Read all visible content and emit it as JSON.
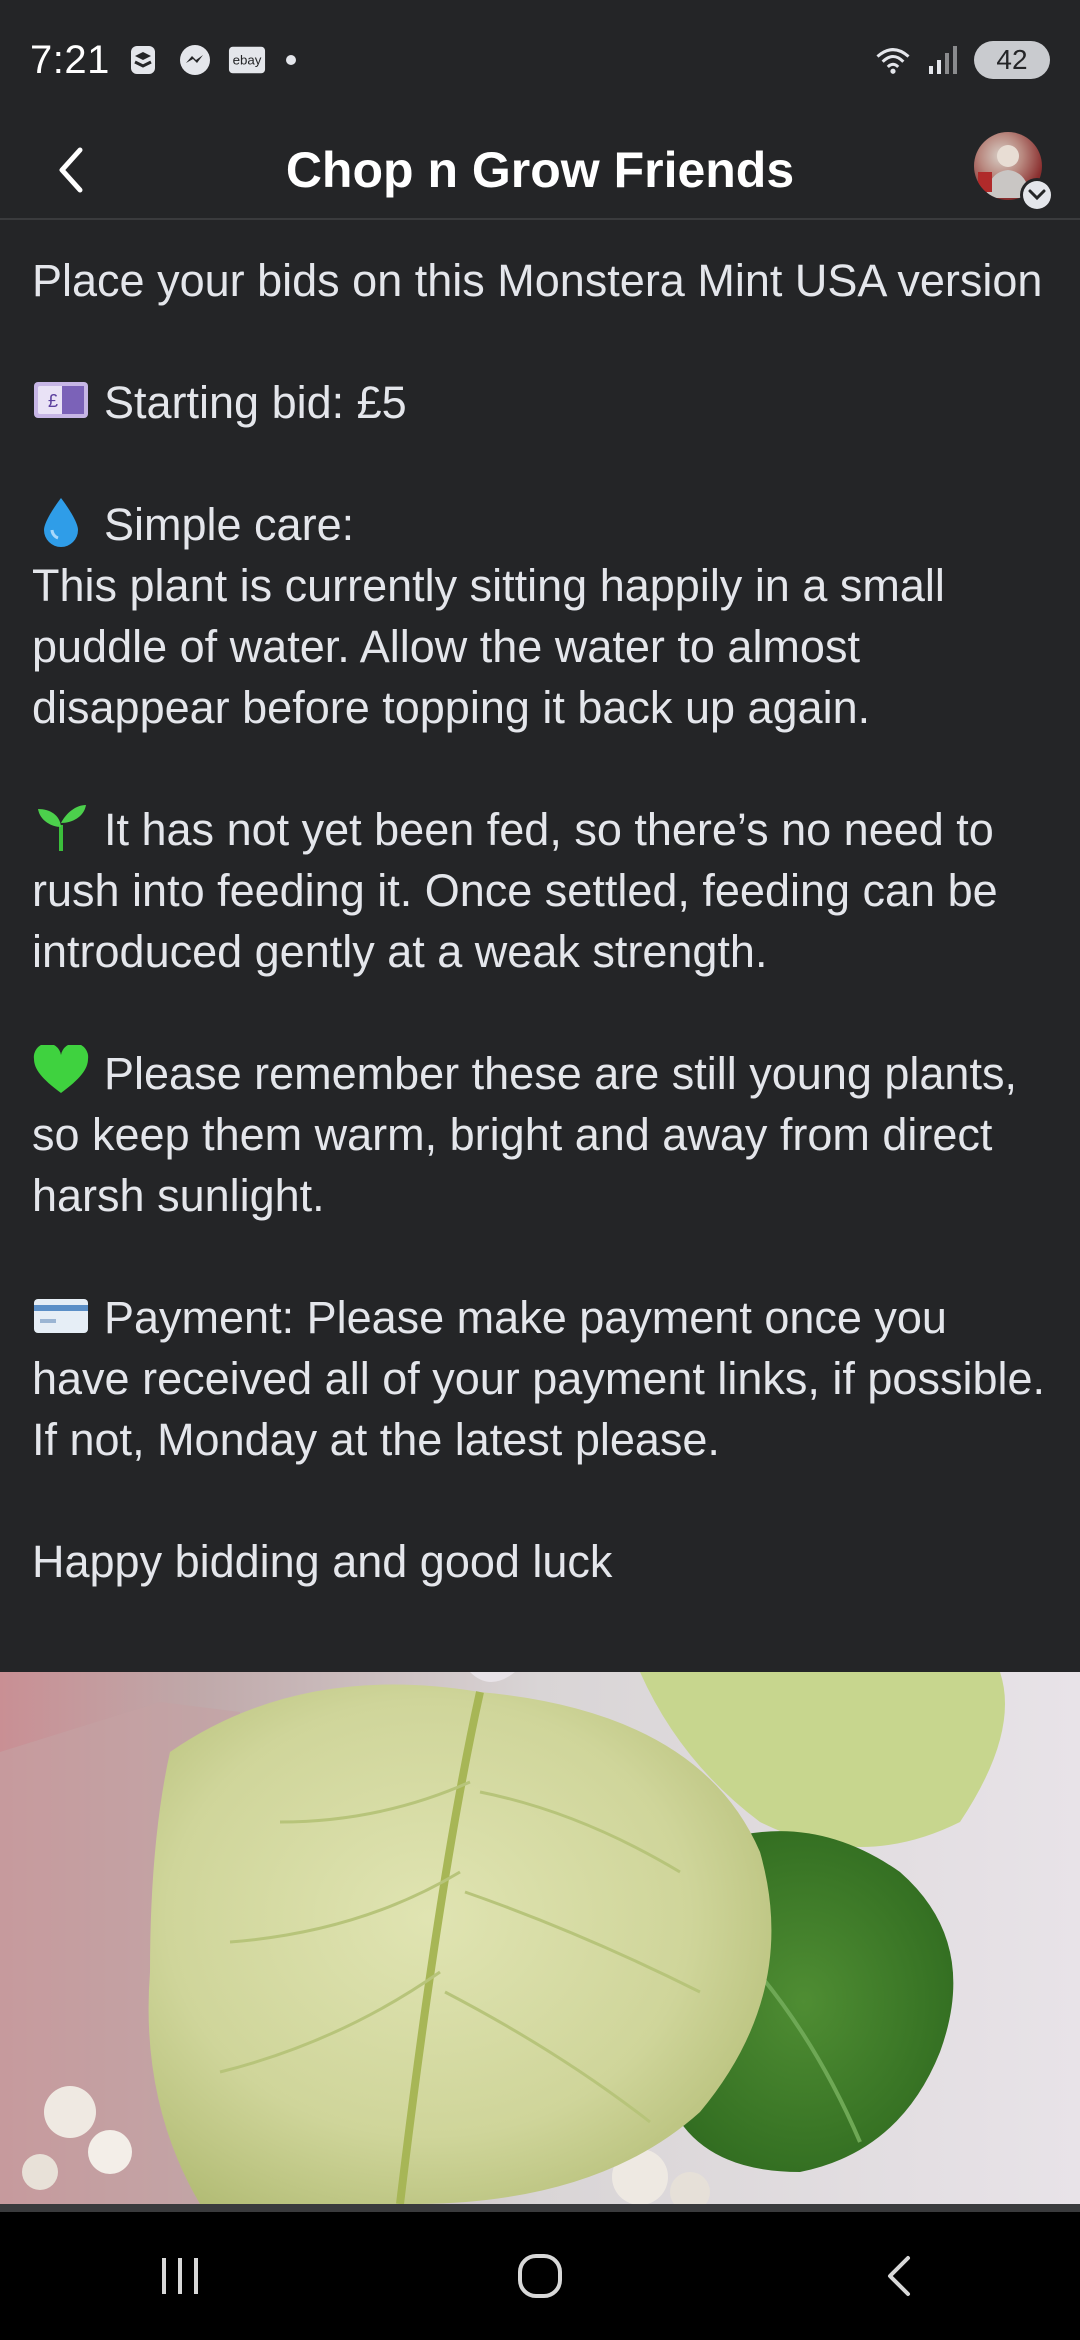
{
  "status_bar": {
    "time": "7:21",
    "notification_icons": [
      "layers-app-icon",
      "messenger-icon",
      "ebay-icon",
      "more-dot"
    ],
    "ebay_label": "ebay",
    "battery_level": "42",
    "connectivity_icons": [
      "wifi-icon",
      "signal-icon"
    ]
  },
  "header": {
    "title": "Chop n Grow Friends",
    "back_icon": "back-arrow-icon",
    "avatar_alt": "profile-avatar"
  },
  "post": {
    "intro": "Place your bids on this Monstera Mint USA version",
    "starting_bid": "Starting bid: £5",
    "care_heading": "Simple care:",
    "care_text": "This plant is currently sitting happily in a small puddle of water. Allow the water to almost disappear before topping it back up again.",
    "feeding_text": "It has not yet been fed, so there’s no need to rush into feeding it. Once settled, feeding can be introduced gently at a weak strength.",
    "young_plants_text": "Please remember these are still young plants, so keep them warm, bright and away from direct harsh sunlight.",
    "payment_text": "Payment: Please make payment once you have received all of your payment links, if possible. If not, Monday at the latest please.",
    "closing": "Happy bidding and good luck"
  },
  "photo": {
    "subject": "monstera-mint-leaf-photo"
  },
  "nav_bar": {
    "recent_icon": "recent-apps-icon",
    "home_icon": "home-icon",
    "back_icon": "back-icon"
  },
  "colors": {
    "background": "#242527",
    "text": "#e4e6eb",
    "nav_background": "#000000"
  }
}
